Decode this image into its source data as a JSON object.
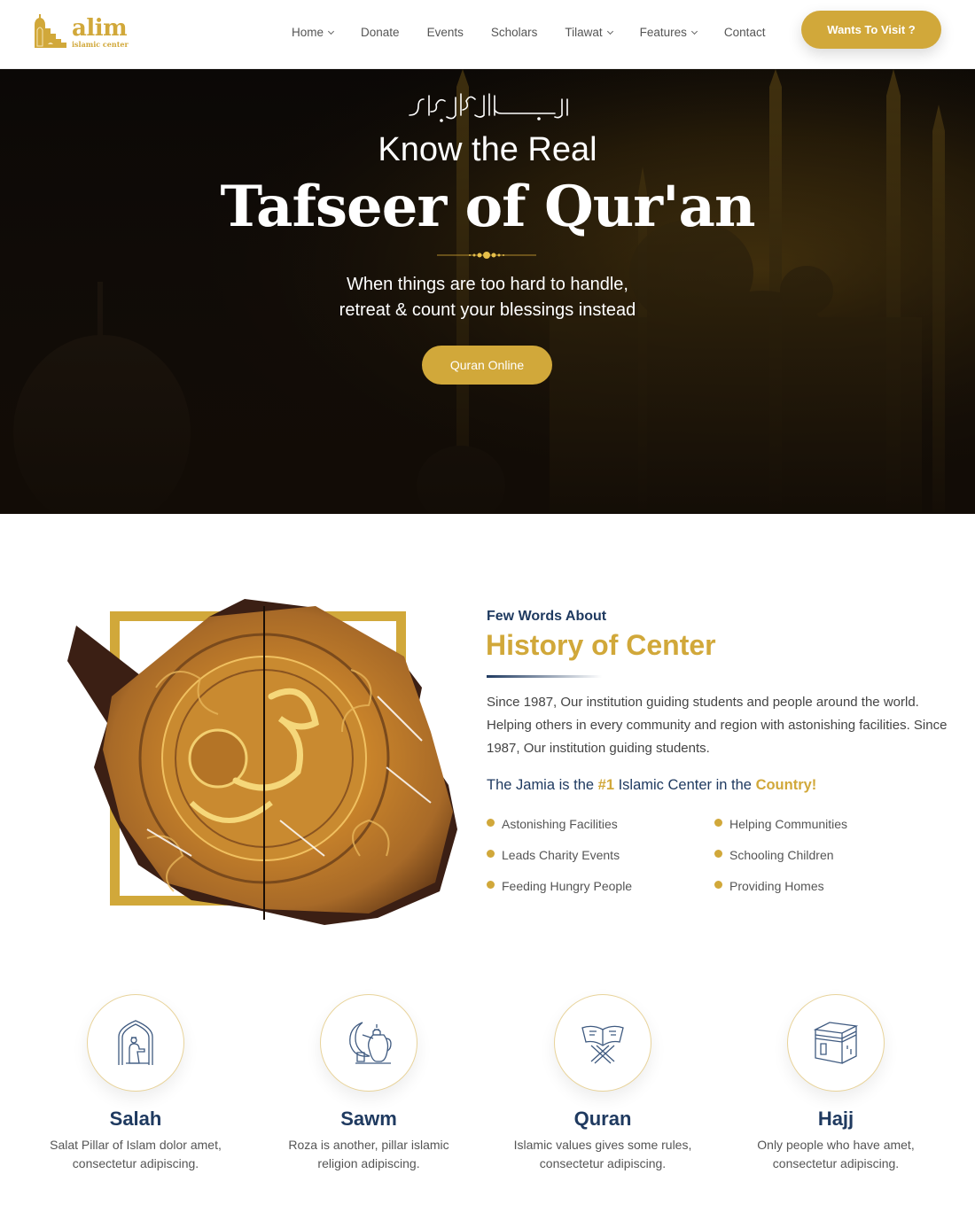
{
  "brand": {
    "name": "alim",
    "tagline": "islamic center",
    "accent_color": "#d1a83a",
    "navy_color": "#1f3a60"
  },
  "nav": {
    "items": [
      {
        "label": "Home",
        "has_dropdown": true
      },
      {
        "label": "Donate",
        "has_dropdown": false
      },
      {
        "label": "Events",
        "has_dropdown": false
      },
      {
        "label": "Scholars",
        "has_dropdown": false
      },
      {
        "label": "Tilawat",
        "has_dropdown": true
      },
      {
        "label": "Features",
        "has_dropdown": true
      },
      {
        "label": "Contact",
        "has_dropdown": false
      }
    ],
    "cta_label": "Wants To Visit ?"
  },
  "hero": {
    "calligraphy": "بسم الله الرحمن الرحيم",
    "kicker": "Know the Real",
    "title": "Tafseer of Qur'an",
    "subtitle_line1": "When things are too hard to handle,",
    "subtitle_line2": "retreat & count your blessings instead",
    "button_label": "Quran Online"
  },
  "history": {
    "kicker": "Few Words About",
    "title": "History of Center",
    "body": "Since 1987, Our institution guiding students and people around the world. Helping others in every community and region with astonishing facilities. Since 1987, Our institution guiding students.",
    "tagline": {
      "part1": "The Jamia is the ",
      "highlight1": "#1",
      "part2": " Islamic Center in the ",
      "highlight2": "Country!"
    },
    "features": [
      "Astonishing Facilities",
      "Helping Communities",
      "Leads Charity Events",
      "Schooling Children",
      "Feeding Hungry People",
      "Providing Homes"
    ]
  },
  "pillars": [
    {
      "icon": "prayer-mihrab-icon",
      "title": "Salah",
      "line1": "Salat Pillar of Islam dolor amet,",
      "line2": "consectetur adipiscing."
    },
    {
      "icon": "crescent-teapot-icon",
      "title": "Sawm",
      "line1": "Roza is another, pillar islamic",
      "line2": "religion adipiscing."
    },
    {
      "icon": "quran-stand-icon",
      "title": "Quran",
      "line1": "Islamic values gives some rules,",
      "line2": "consectetur adipiscing."
    },
    {
      "icon": "kaaba-icon",
      "title": "Hajj",
      "line1": "Only people who have amet,",
      "line2": "consectetur adipiscing."
    }
  ]
}
